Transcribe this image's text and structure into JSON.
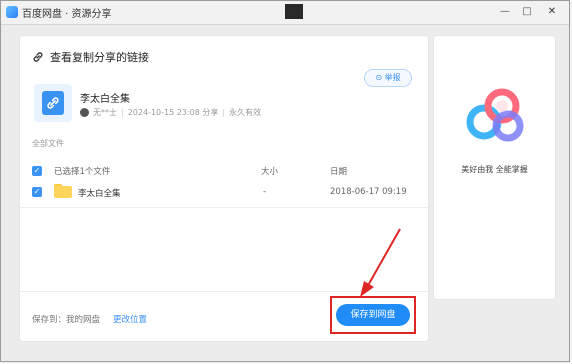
{
  "window": {
    "title": "百度网盘 · 资源分享",
    "minimize": "—",
    "maximize": "□",
    "close": "✕"
  },
  "share": {
    "title": "查看复制分享的链接",
    "report": "⊙ 举报",
    "file_main": "李太白全集",
    "meta": {
      "sharer": "无**士",
      "datetime": "2024-10-15 23:08 分享",
      "validity": "永久有效"
    }
  },
  "files": {
    "section_label": "全部文件",
    "header": {
      "name": "已选择1个文件",
      "size": "大小",
      "date": "日期"
    },
    "rows": [
      {
        "name": "李太白全集",
        "size": "-",
        "date": "2018-06-17 09:19"
      }
    ]
  },
  "footer": {
    "save_to": "保存到：我的网盘",
    "change": "更改位置",
    "save_button": "保存到网盘"
  },
  "side": {
    "caption": "美好由我   全能掌握"
  },
  "colors": {
    "accent": "#1f8cf7",
    "highlight": "#e02525",
    "folder": "#ffd45a"
  },
  "icons": {
    "title": "link-icon",
    "file": "link-file-icon",
    "folder": "folder-icon",
    "checkbox": "checkbox-checked-icon",
    "side_logo": "baidu-netdisk-logo"
  }
}
